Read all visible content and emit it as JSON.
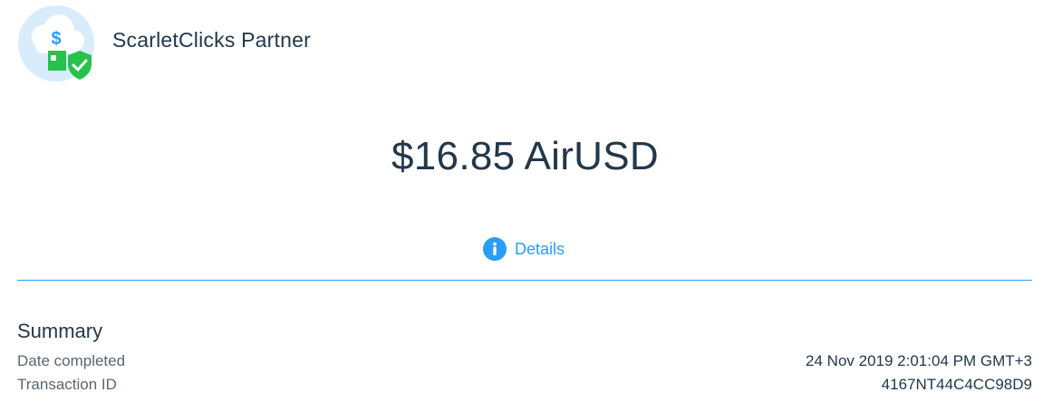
{
  "header": {
    "merchant_name": "ScarletClicks Partner",
    "logo_icon": "cloud-money-shield-icon"
  },
  "amount": "$16.85 AirUSD",
  "details": {
    "label": "Details",
    "icon": "info-icon"
  },
  "summary": {
    "title": "Summary",
    "rows": [
      {
        "label": "Date completed",
        "value": "24 Nov 2019 2:01:04 PM GMT+3"
      },
      {
        "label": "Transaction ID",
        "value": "4167NT44C4CC98D9"
      }
    ]
  },
  "colors": {
    "accent": "#2a9df4",
    "text": "#22384a",
    "muted": "#5b6672",
    "logo_bg": "#d8ecfb",
    "logo_green": "#27c24c"
  }
}
